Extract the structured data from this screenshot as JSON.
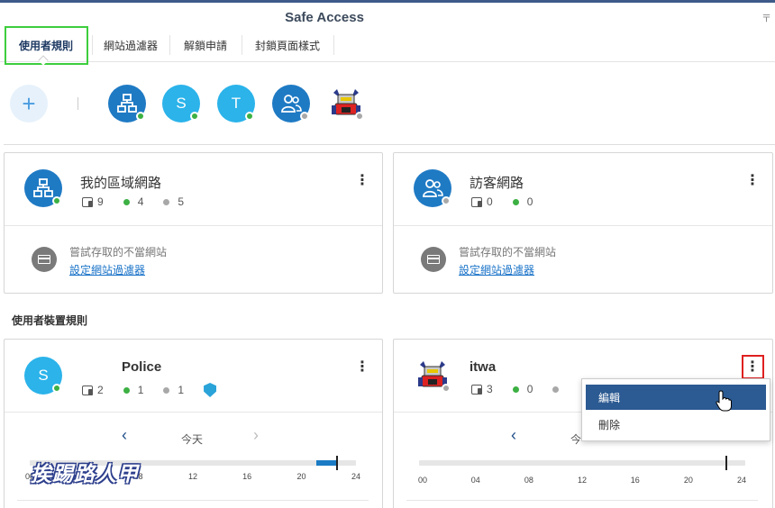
{
  "app": {
    "title": "Safe Access"
  },
  "tabs": [
    {
      "label": "使用者規則",
      "active": true
    },
    {
      "label": "網站過濾器"
    },
    {
      "label": "解鎖申請"
    },
    {
      "label": "封鎖頁面樣式"
    }
  ],
  "avatars": [
    {
      "type": "network",
      "status": "online"
    },
    {
      "letter": "S",
      "status": "online"
    },
    {
      "letter": "T",
      "status": "online"
    },
    {
      "type": "guest",
      "status": "offline"
    },
    {
      "type": "robot",
      "status": "offline"
    }
  ],
  "network_cards": [
    {
      "title": "我的區域網路",
      "devices": "9",
      "online": "4",
      "offline": "5",
      "blocked_text": "嘗試存取的不當網站",
      "link": "設定網站過濾器"
    },
    {
      "title": "訪客網路",
      "devices": "0",
      "online": "0",
      "blocked_text": "嘗試存取的不當網站",
      "link": "設定網站過濾器"
    }
  ],
  "section_label": "使用者裝置規則",
  "user_cards": [
    {
      "title": "Police",
      "avatar_letter": "S",
      "devices": "2",
      "online": "1",
      "offline": "1",
      "day_label": "今天",
      "ticks": [
        "00",
        "04",
        "08",
        "12",
        "16",
        "20",
        "24"
      ]
    },
    {
      "title": "itwa",
      "devices": "3",
      "online": "0",
      "day_label": "今",
      "ticks": [
        "00",
        "04",
        "08",
        "12",
        "16",
        "20",
        "24"
      ]
    }
  ],
  "context_menu": {
    "items": [
      "編輯",
      "刪除"
    ]
  },
  "watermark": "挨踢路人甲",
  "colors": {
    "accent": "#1f7ac4",
    "online": "#3cb043",
    "offline": "#a8a8a8",
    "highlight": "#2c5a92"
  }
}
